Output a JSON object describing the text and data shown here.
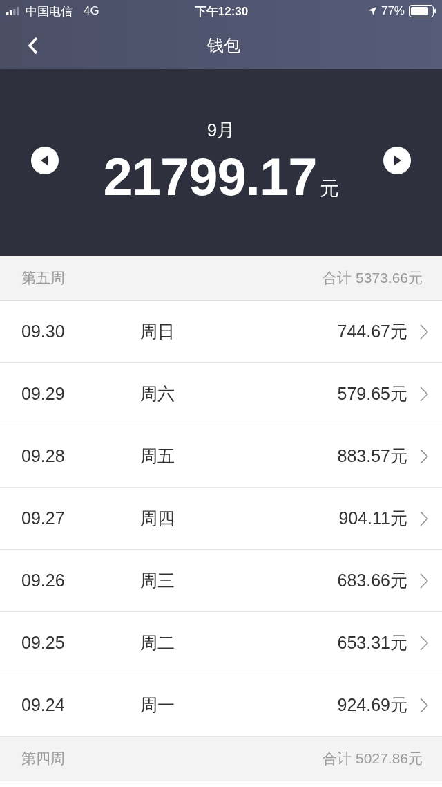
{
  "status_bar": {
    "carrier": "中国电信",
    "network": "4G",
    "time": "下午12:30",
    "battery": "77%"
  },
  "nav": {
    "title": "钱包"
  },
  "summary": {
    "month": "9月",
    "amount": "21799.17",
    "unit": "元"
  },
  "weeks": [
    {
      "title": "第五周",
      "total": "合计 5373.66元",
      "days": [
        {
          "date": "09.30",
          "weekday": "周日",
          "amount": "744.67元"
        },
        {
          "date": "09.29",
          "weekday": "周六",
          "amount": "579.65元"
        },
        {
          "date": "09.28",
          "weekday": "周五",
          "amount": "883.57元"
        },
        {
          "date": "09.27",
          "weekday": "周四",
          "amount": "904.11元"
        },
        {
          "date": "09.26",
          "weekday": "周三",
          "amount": "683.66元"
        },
        {
          "date": "09.25",
          "weekday": "周二",
          "amount": "653.31元"
        },
        {
          "date": "09.24",
          "weekday": "周一",
          "amount": "924.69元"
        }
      ]
    },
    {
      "title": "第四周",
      "total": "合计 5027.86元"
    }
  ]
}
